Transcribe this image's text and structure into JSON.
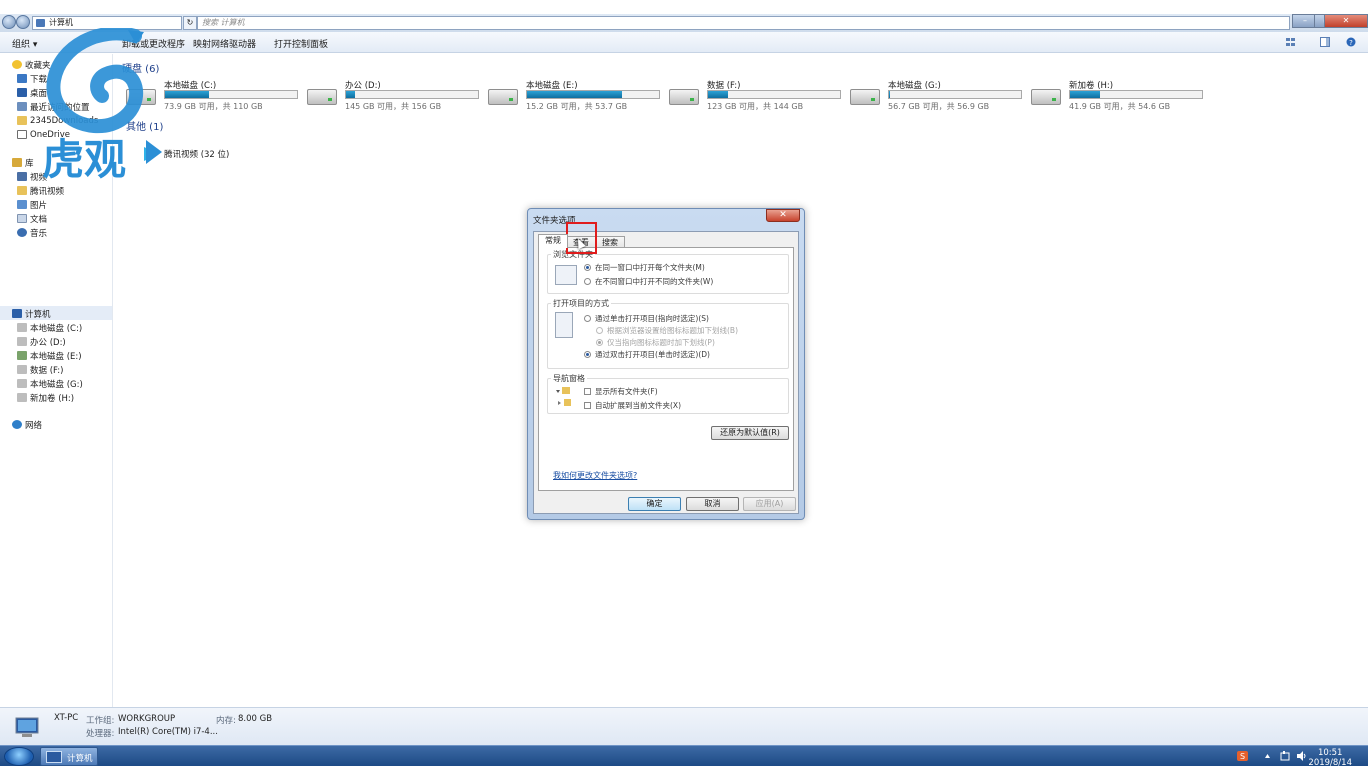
{
  "address_bar": {
    "path_icon": "computer-icon",
    "path_label": "计算机",
    "search_placeholder": "搜索 计算机",
    "refresh_label": "↻"
  },
  "window_controls": {
    "minimize": "–",
    "maximize": "▭",
    "close": "✕"
  },
  "toolbar": {
    "organize": "组织 ▾",
    "uninstall": "卸载或更改程序",
    "map_drive": "映射网络驱动器",
    "control_panel": "打开控制面板"
  },
  "sidebar": {
    "favorites": "收藏夹",
    "downloads": "下载",
    "desktop": "桌面",
    "recent": "最近访问的位置",
    "folder_2345": "2345Downloads",
    "onedrive": "OneDrive",
    "libraries": "库",
    "videos": "视频",
    "tencent_video": "腾讯视频",
    "pictures": "图片",
    "documents": "文档",
    "music": "音乐",
    "computer": "计算机",
    "drive_c": "本地磁盘 (C:)",
    "drive_d": "办公 (D:)",
    "drive_e": "本地磁盘 (E:)",
    "drive_f": "数据 (F:)",
    "drive_g": "本地磁盘 (G:)",
    "drive_h": "新加卷 (H:)",
    "network": "网络"
  },
  "main": {
    "hdd_section": "硬盘 (6)",
    "other_section": "其他 (1)",
    "drives": [
      {
        "name": "本地磁盘 (C:)",
        "info": "73.9 GB 可用，共 110 GB",
        "used_fraction": 0.33
      },
      {
        "name": "办公 (D:)",
        "info": "145 GB 可用，共 156 GB",
        "used_fraction": 0.07
      },
      {
        "name": "本地磁盘 (E:)",
        "info": "15.2 GB 可用，共 53.7 GB",
        "used_fraction": 0.72
      },
      {
        "name": "数据 (F:)",
        "info": "123 GB 可用，共 144 GB",
        "used_fraction": 0.15
      },
      {
        "name": "本地磁盘 (G:)",
        "info": "56.7 GB 可用，共 56.9 GB",
        "used_fraction": 0.01
      },
      {
        "name": "新加卷 (H:)",
        "info": "41.9 GB 可用，共 54.6 GB",
        "used_fraction": 0.23
      }
    ],
    "other_item": "腾讯视频 (32 位)"
  },
  "details": {
    "pc_name": "XT-PC",
    "workgroup_label": "工作组:",
    "workgroup_value": "WORKGROUP",
    "memory_label": "内存:",
    "memory_value": "8.00 GB",
    "cpu_label": "处理器:",
    "cpu_value": "Intel(R) Core(TM) i7-4..."
  },
  "taskbar": {
    "task_label": "计算机",
    "time": "10:51",
    "date": "2019/8/14"
  },
  "logo": {
    "text": "虎观"
  },
  "dialog": {
    "title": "文件夹选项",
    "close": "✕",
    "tabs": [
      "常规",
      "查看",
      "搜索"
    ],
    "browse_group": "浏览文件夹",
    "browse_same": "在同一窗口中打开每个文件夹(M)",
    "browse_new": "在不同窗口中打开不同的文件夹(W)",
    "click_group": "打开项目的方式",
    "single_click": "通过单击打开项目(指向时选定)(S)",
    "underline_browser": "根据浏览器设置给图标标题加下划线(B)",
    "underline_point": "仅当指向图标标题时加下划线(P)",
    "double_click": "通过双击打开项目(单击时选定)(D)",
    "nav_group": "导航窗格",
    "show_all": "显示所有文件夹(F)",
    "auto_expand": "自动扩展到当前文件夹(X)",
    "restore": "还原为默认值(R)",
    "help_link": "我如何更改文件夹选项?",
    "ok": "确定",
    "cancel": "取消",
    "apply": "应用(A)"
  },
  "colors": {
    "accent": "#2a5aa0",
    "highlight_box": "#e01c1c",
    "drive_bar": "#1680b5",
    "section_title": "#1e3f8a"
  }
}
